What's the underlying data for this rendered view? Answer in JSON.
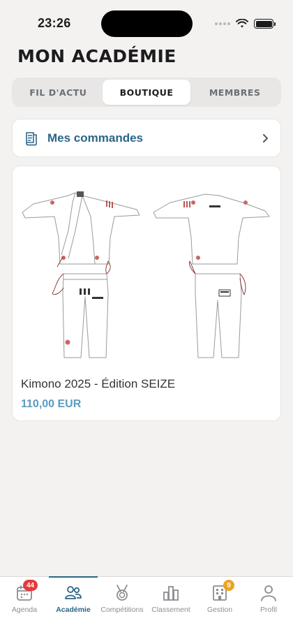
{
  "status": {
    "time": "23:26"
  },
  "page": {
    "title": "MON ACADÉMIE"
  },
  "tabs_top": [
    {
      "label": "FIL D'ACTU",
      "active": false
    },
    {
      "label": "BOUTIQUE",
      "active": true
    },
    {
      "label": "MEMBRES",
      "active": false
    }
  ],
  "orders": {
    "label": "Mes commandes",
    "icon": "receipt-icon"
  },
  "product": {
    "name": "Kimono 2025 - Édition SEIZE",
    "price": "110,00 EUR",
    "image": "white-kimono-front-back"
  },
  "tab_bar": {
    "items": [
      {
        "label": "Agenda",
        "icon": "calendar-icon",
        "badge": "44"
      },
      {
        "label": "Académie",
        "icon": "people-icon",
        "active": true
      },
      {
        "label": "Compétitions",
        "icon": "medal-icon"
      },
      {
        "label": "Classement",
        "icon": "bar-chart-icon"
      },
      {
        "label": "Gestion",
        "icon": "building-icon",
        "badge": "9"
      },
      {
        "label": "Profil",
        "icon": "person-icon"
      }
    ]
  },
  "colors": {
    "accent": "#2b6587",
    "price": "#5c9bbf",
    "badge_red": "#e23b3b",
    "badge_orange": "#eda321",
    "background": "#f3f2f0"
  }
}
